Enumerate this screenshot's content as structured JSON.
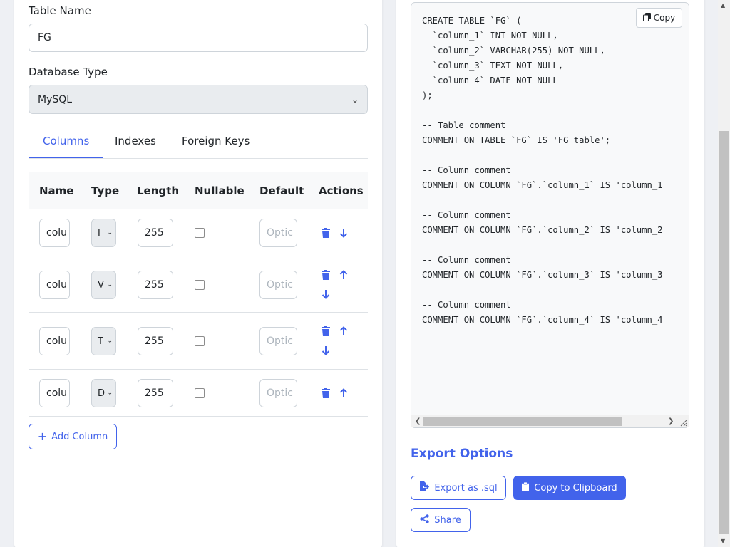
{
  "form": {
    "table_name_label": "Table Name",
    "table_name_value": "FG",
    "db_type_label": "Database Type",
    "db_type_value": "MySQL"
  },
  "tabs": [
    {
      "label": "Columns",
      "active": true
    },
    {
      "label": "Indexes",
      "active": false
    },
    {
      "label": "Foreign Keys",
      "active": false
    }
  ],
  "table": {
    "headers": [
      "Name",
      "Type",
      "Length",
      "Nullable",
      "Default",
      "Actions"
    ],
    "rows": [
      {
        "name": "colu",
        "type": "I",
        "length": "255",
        "nullable": false,
        "default_placeholder": "Optic",
        "actions": [
          "delete",
          "move-down"
        ]
      },
      {
        "name": "colu",
        "type": "V",
        "length": "255",
        "nullable": false,
        "default_placeholder": "Optic",
        "actions": [
          "delete",
          "move-up",
          "move-down"
        ]
      },
      {
        "name": "colu",
        "type": "T",
        "length": "255",
        "nullable": false,
        "default_placeholder": "Optic",
        "actions": [
          "delete",
          "move-up",
          "move-down"
        ]
      },
      {
        "name": "colu",
        "type": "D",
        "length": "255",
        "nullable": false,
        "default_placeholder": "Optic",
        "actions": [
          "delete",
          "move-up"
        ]
      }
    ]
  },
  "add_column_label": "Add Column",
  "sql": {
    "copy_label": "Copy",
    "code": "CREATE TABLE `FG` (\n  `column_1` INT NOT NULL,\n  `column_2` VARCHAR(255) NOT NULL,\n  `column_3` TEXT NOT NULL,\n  `column_4` DATE NOT NULL\n);\n\n-- Table comment\nCOMMENT ON TABLE `FG` IS 'FG table';\n\n-- Column comment\nCOMMENT ON COLUMN `FG`.`column_1` IS 'column_1\n\n-- Column comment\nCOMMENT ON COLUMN `FG`.`column_2` IS 'column_2\n\n-- Column comment\nCOMMENT ON COLUMN `FG`.`column_3` IS 'column_3\n\n-- Column comment\nCOMMENT ON COLUMN `FG`.`column_4` IS 'column_4"
  },
  "export": {
    "title": "Export Options",
    "export_sql_label": "Export as .sql",
    "copy_clipboard_label": "Copy to Clipboard",
    "share_label": "Share"
  },
  "colors": {
    "accent": "#4263eb",
    "background": "#eef0f4"
  }
}
